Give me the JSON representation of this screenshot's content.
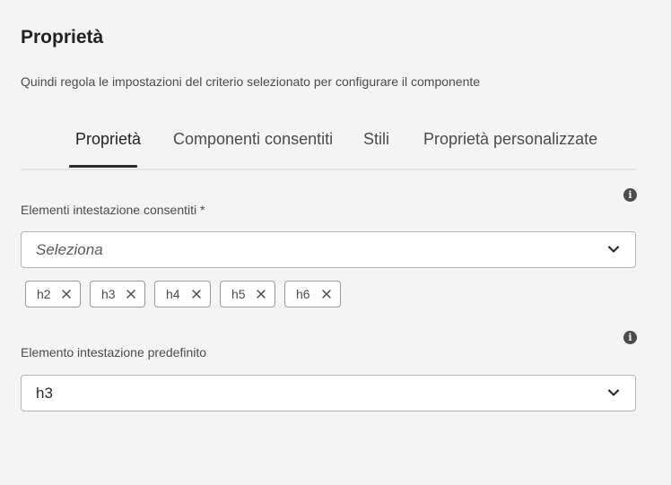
{
  "panel": {
    "title": "Proprietà",
    "description": "Quindi regola le impostazioni del criterio selezionato per configurare il componente"
  },
  "tabs": [
    {
      "label": "Proprietà",
      "active": true
    },
    {
      "label": "Componenti consentiti",
      "active": false
    },
    {
      "label": "Stili",
      "active": false
    },
    {
      "label": "Proprietà personalizzate",
      "active": false
    }
  ],
  "allowed_headings": {
    "label": "Elementi intestazione consentiti *",
    "placeholder": "Seleziona",
    "tags": [
      {
        "label": "h2"
      },
      {
        "label": "h3"
      },
      {
        "label": "h4"
      },
      {
        "label": "h5"
      },
      {
        "label": "h6"
      }
    ]
  },
  "default_heading": {
    "label": "Elemento intestazione predefinito",
    "value": "h3"
  },
  "icons": {
    "info": "info-icon",
    "chevron": "chevron-down-icon",
    "remove": "close-icon"
  }
}
